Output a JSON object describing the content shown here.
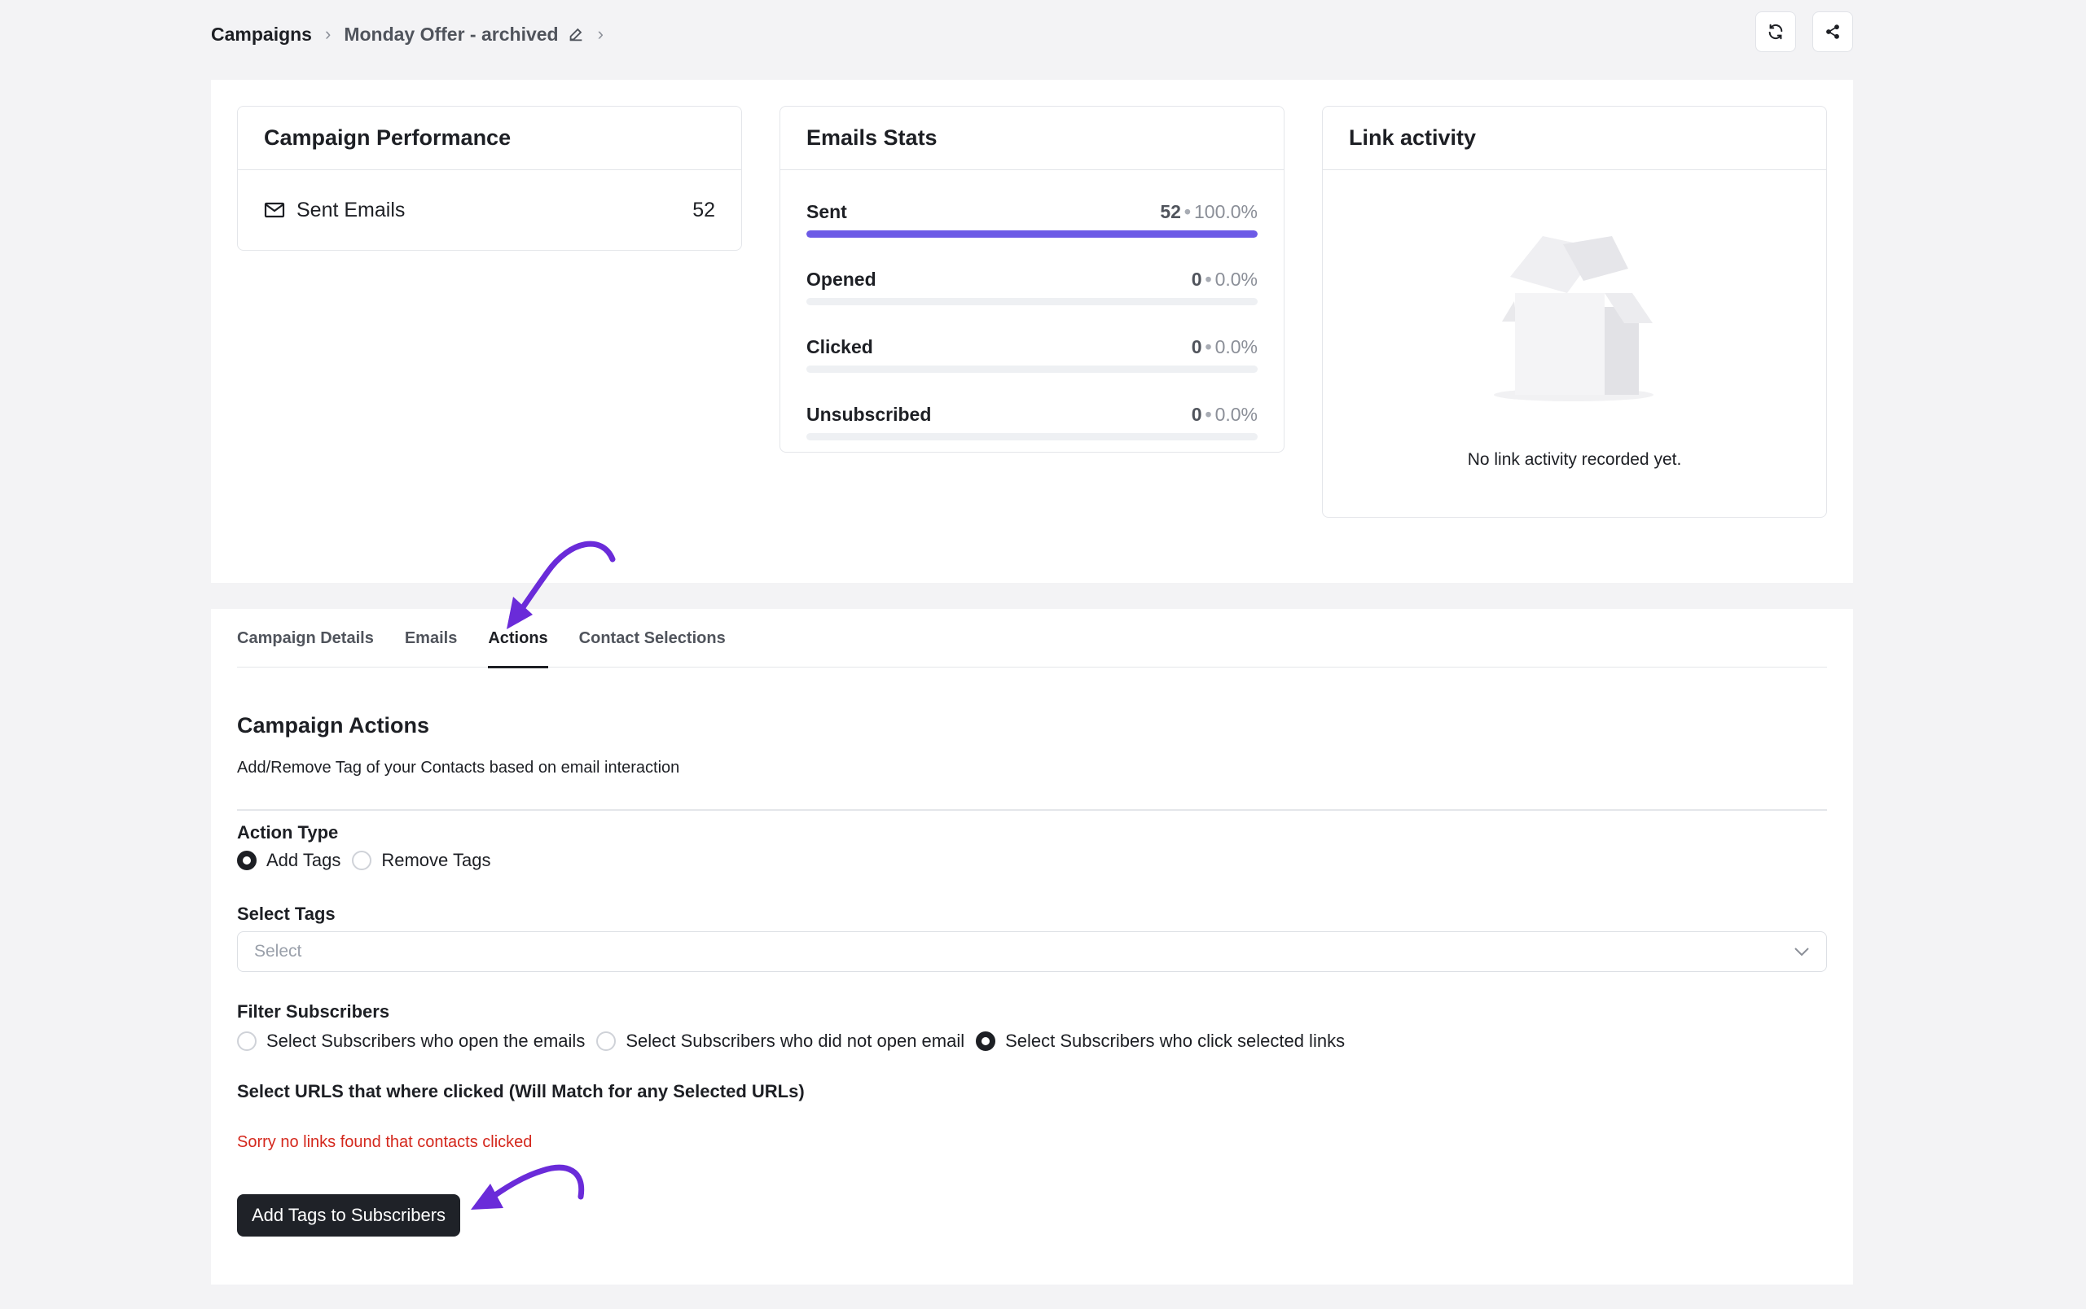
{
  "breadcrumb": {
    "root": "Campaigns",
    "current": "Monday Offer - archived"
  },
  "top_actions": {
    "refresh_icon": "refresh-icon",
    "share_icon": "share-icon"
  },
  "performance": {
    "title": "Campaign Performance",
    "sent_label": "Sent Emails",
    "sent_value": "52"
  },
  "emails_stats": {
    "title": "Emails Stats",
    "rows": [
      {
        "label": "Sent",
        "count": "52",
        "percent": "100.0%",
        "fill": 1.0
      },
      {
        "label": "Opened",
        "count": "0",
        "percent": "0.0%",
        "fill": 0.0
      },
      {
        "label": "Clicked",
        "count": "0",
        "percent": "0.0%",
        "fill": 0.0
      },
      {
        "label": "Unsubscribed",
        "count": "0",
        "percent": "0.0%",
        "fill": 0.0
      }
    ],
    "bar_color": "#6c5ae6"
  },
  "link_activity": {
    "title": "Link activity",
    "empty_text": "No link activity recorded yet."
  },
  "tabs": [
    {
      "label": "Campaign Details",
      "active": false
    },
    {
      "label": "Emails",
      "active": false
    },
    {
      "label": "Actions",
      "active": true
    },
    {
      "label": "Contact Selections",
      "active": false
    }
  ],
  "actions": {
    "title": "Campaign Actions",
    "description": "Add/Remove Tag of your Contacts based on email interaction",
    "action_type_label": "Action Type",
    "action_types": [
      {
        "label": "Add Tags",
        "selected": true
      },
      {
        "label": "Remove Tags",
        "selected": false
      }
    ],
    "select_tags_label": "Select Tags",
    "select_placeholder": "Select",
    "filter_label": "Filter Subscribers",
    "filters": [
      {
        "label": "Select Subscribers who open the emails",
        "selected": false
      },
      {
        "label": "Select Subscribers who did not open email",
        "selected": false
      },
      {
        "label": "Select Subscribers who click selected links",
        "selected": true
      }
    ],
    "urls_label": "Select URLS that where clicked (Will Match for any Selected URLs)",
    "error_text": "Sorry no links found that contacts clicked",
    "submit_label": "Add Tags to Subscribers"
  },
  "colors": {
    "annotation_arrow": "#6a2bd9",
    "error": "#d4281d",
    "primary_button": "#1f2228"
  }
}
